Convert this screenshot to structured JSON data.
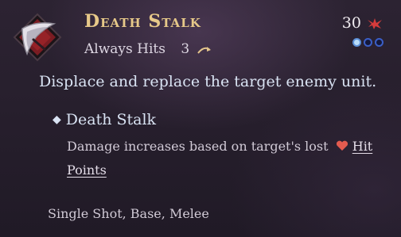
{
  "ability": {
    "name": "Death Stalk",
    "hit_type": "Always Hits",
    "range": "3",
    "cost": "30",
    "pips": {
      "filled": 1,
      "total": 3
    },
    "description": "Displace and replace the target enemy unit.",
    "effect": {
      "name": "Death Stalk",
      "text": "Damage increases based on target's lost",
      "link": "Hit Points"
    },
    "tags": "Single Shot, Base, Melee"
  },
  "icons": {
    "ability": "scythe-blade-icon",
    "range": "arc-arrow-icon",
    "cost": "red-burst-icon",
    "heart": "heart-icon",
    "bullet": "diamond-icon"
  },
  "colors": {
    "title": "#e7c989",
    "pip_filled": "#b9ddfa",
    "pip_empty": "#14183a",
    "heart": "#e35b4f"
  }
}
